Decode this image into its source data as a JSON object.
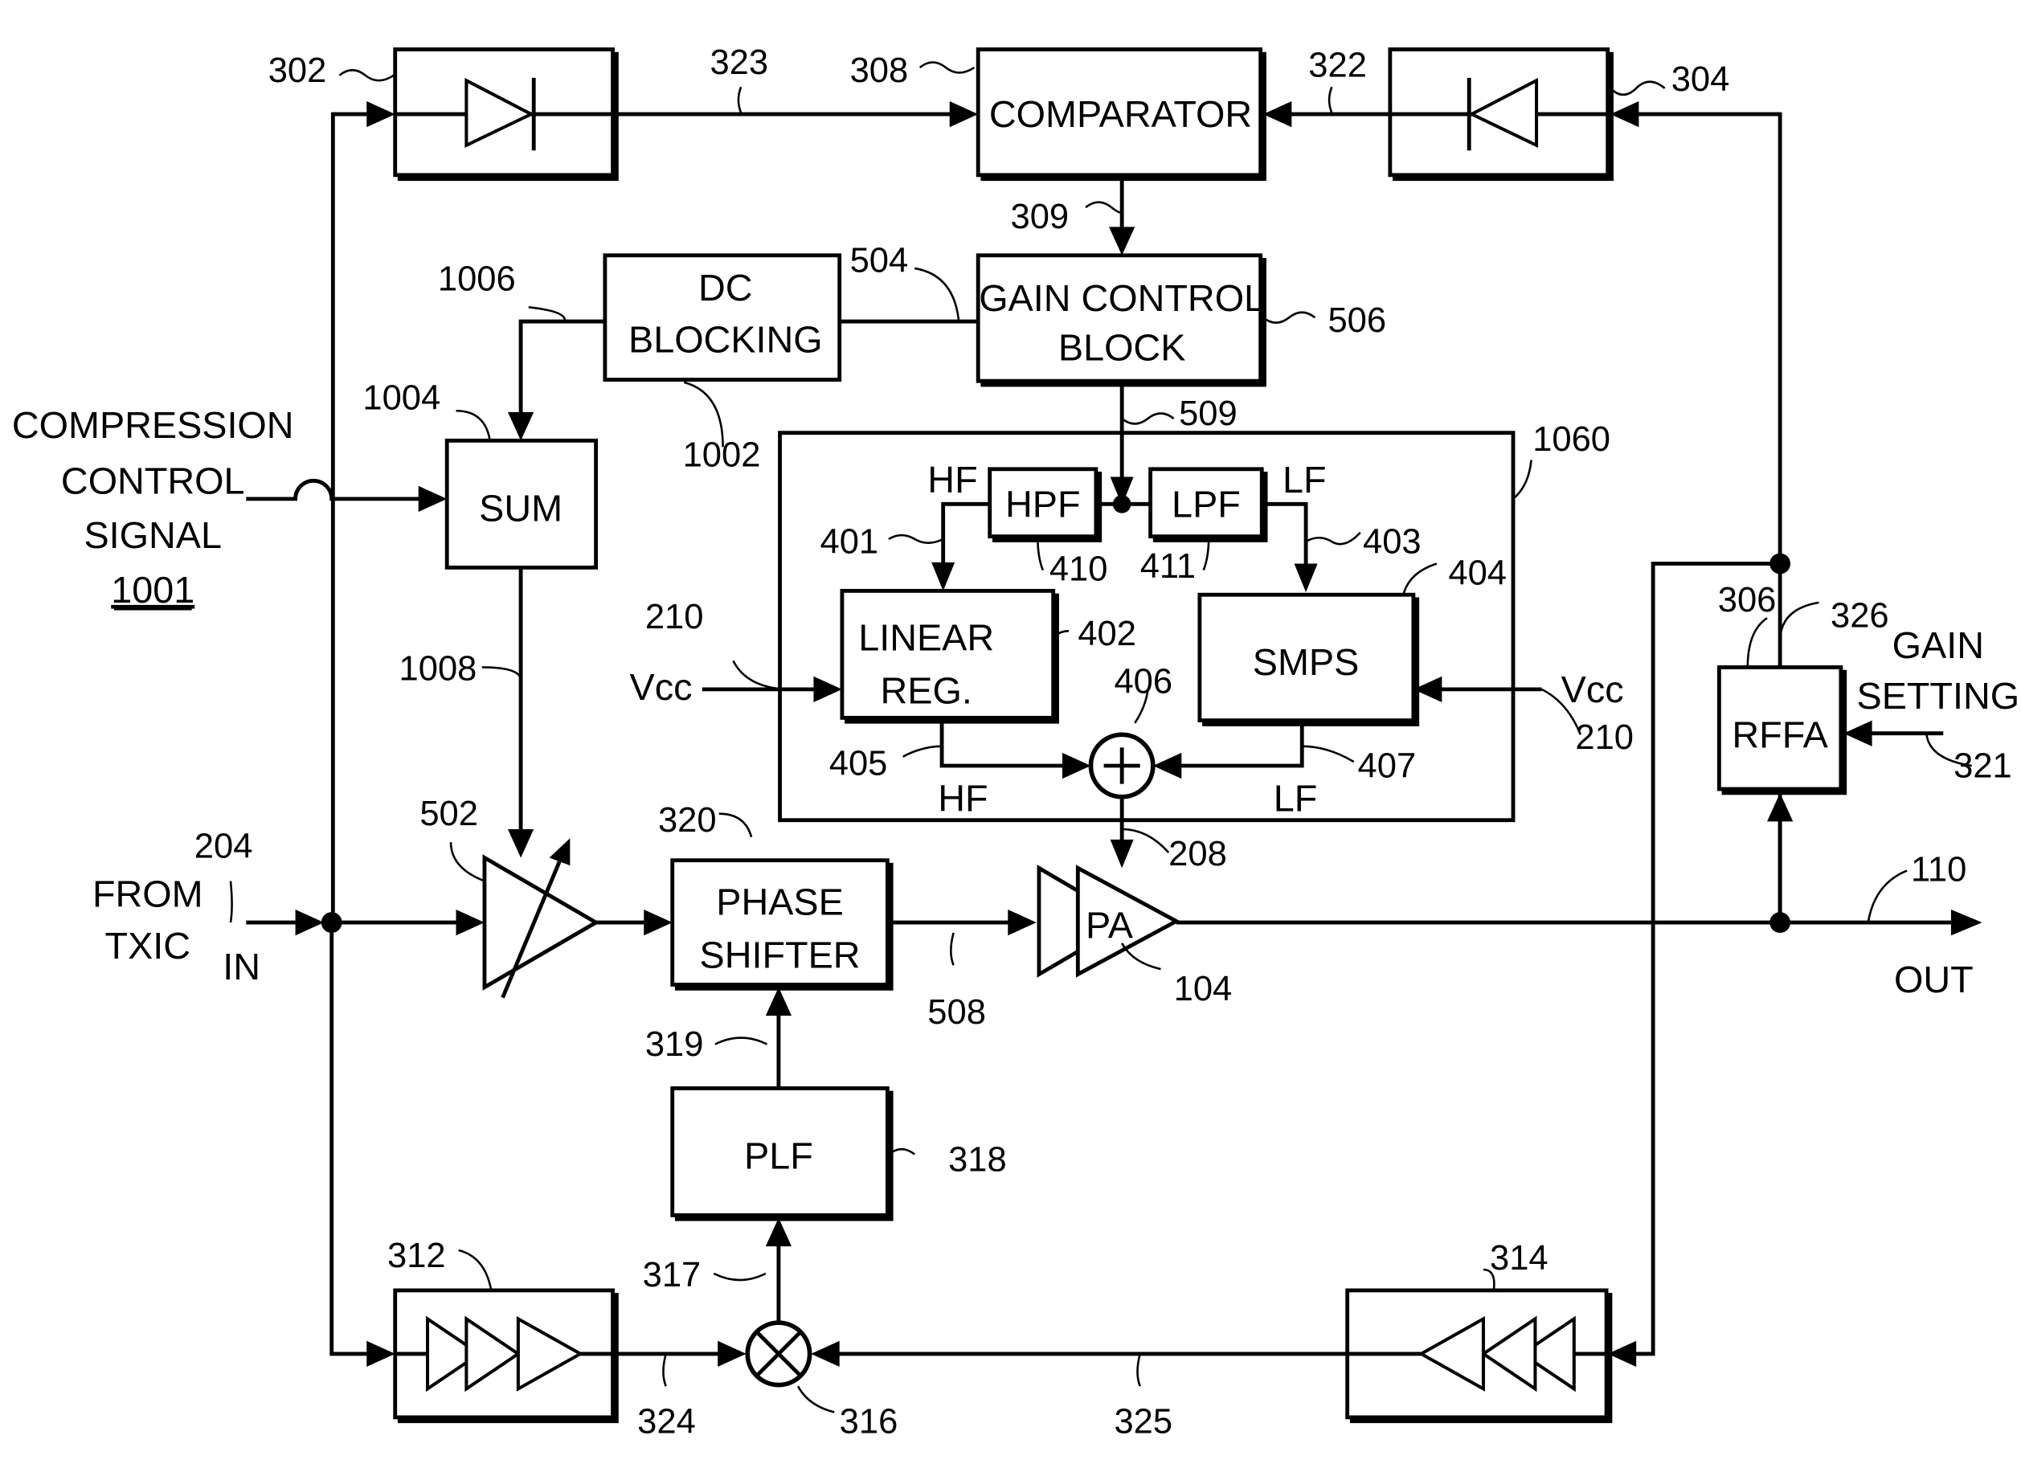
{
  "blocks": {
    "comparator": "COMPARATOR",
    "gain_control_1": "GAIN CONTROL",
    "gain_control_2": "BLOCK",
    "dc_blocking_1": "DC",
    "dc_blocking_2": "BLOCKING",
    "sum": "SUM",
    "hpf": "HPF",
    "lpf": "LPF",
    "linear_reg_1": "LINEAR",
    "linear_reg_2": "REG.",
    "smps": "SMPS",
    "phase_shifter_1": "PHASE",
    "phase_shifter_2": "SHIFTER",
    "pa": "PA",
    "plf": "PLF",
    "rffa": "RFFA"
  },
  "signals": {
    "compression_1": "COMPRESSION",
    "compression_2": "CONTROL",
    "compression_3": "SIGNAL",
    "compression_ref": "1001",
    "from_1": "FROM",
    "from_2": "TXIC",
    "in": "IN",
    "out": "OUT",
    "gain_setting_1": "GAIN",
    "gain_setting_2": "SETTING",
    "vcc": "Vcc",
    "hf": "HF",
    "lf": "LF"
  },
  "refs": {
    "r302": "302",
    "r323": "323",
    "r308": "308",
    "r322": "322",
    "r304": "304",
    "r309": "309",
    "r504": "504",
    "r506": "506",
    "r1006": "1006",
    "r1004": "1004",
    "r1002": "1002",
    "r509": "509",
    "r1060": "1060",
    "r401": "401",
    "r410": "410",
    "r411": "411",
    "r403": "403",
    "r404": "404",
    "r402": "402",
    "r210a": "210",
    "r210b": "210",
    "r406": "406",
    "r405": "405",
    "r407": "407",
    "r306": "306",
    "r326": "326",
    "r321": "321",
    "r1008": "1008",
    "r502": "502",
    "r204": "204",
    "r320": "320",
    "r208": "208",
    "r110": "110",
    "r508": "508",
    "r104": "104",
    "r319": "319",
    "r318": "318",
    "r312": "312",
    "r314": "314",
    "r317": "317",
    "r324": "324",
    "r316": "316",
    "r325": "325"
  }
}
